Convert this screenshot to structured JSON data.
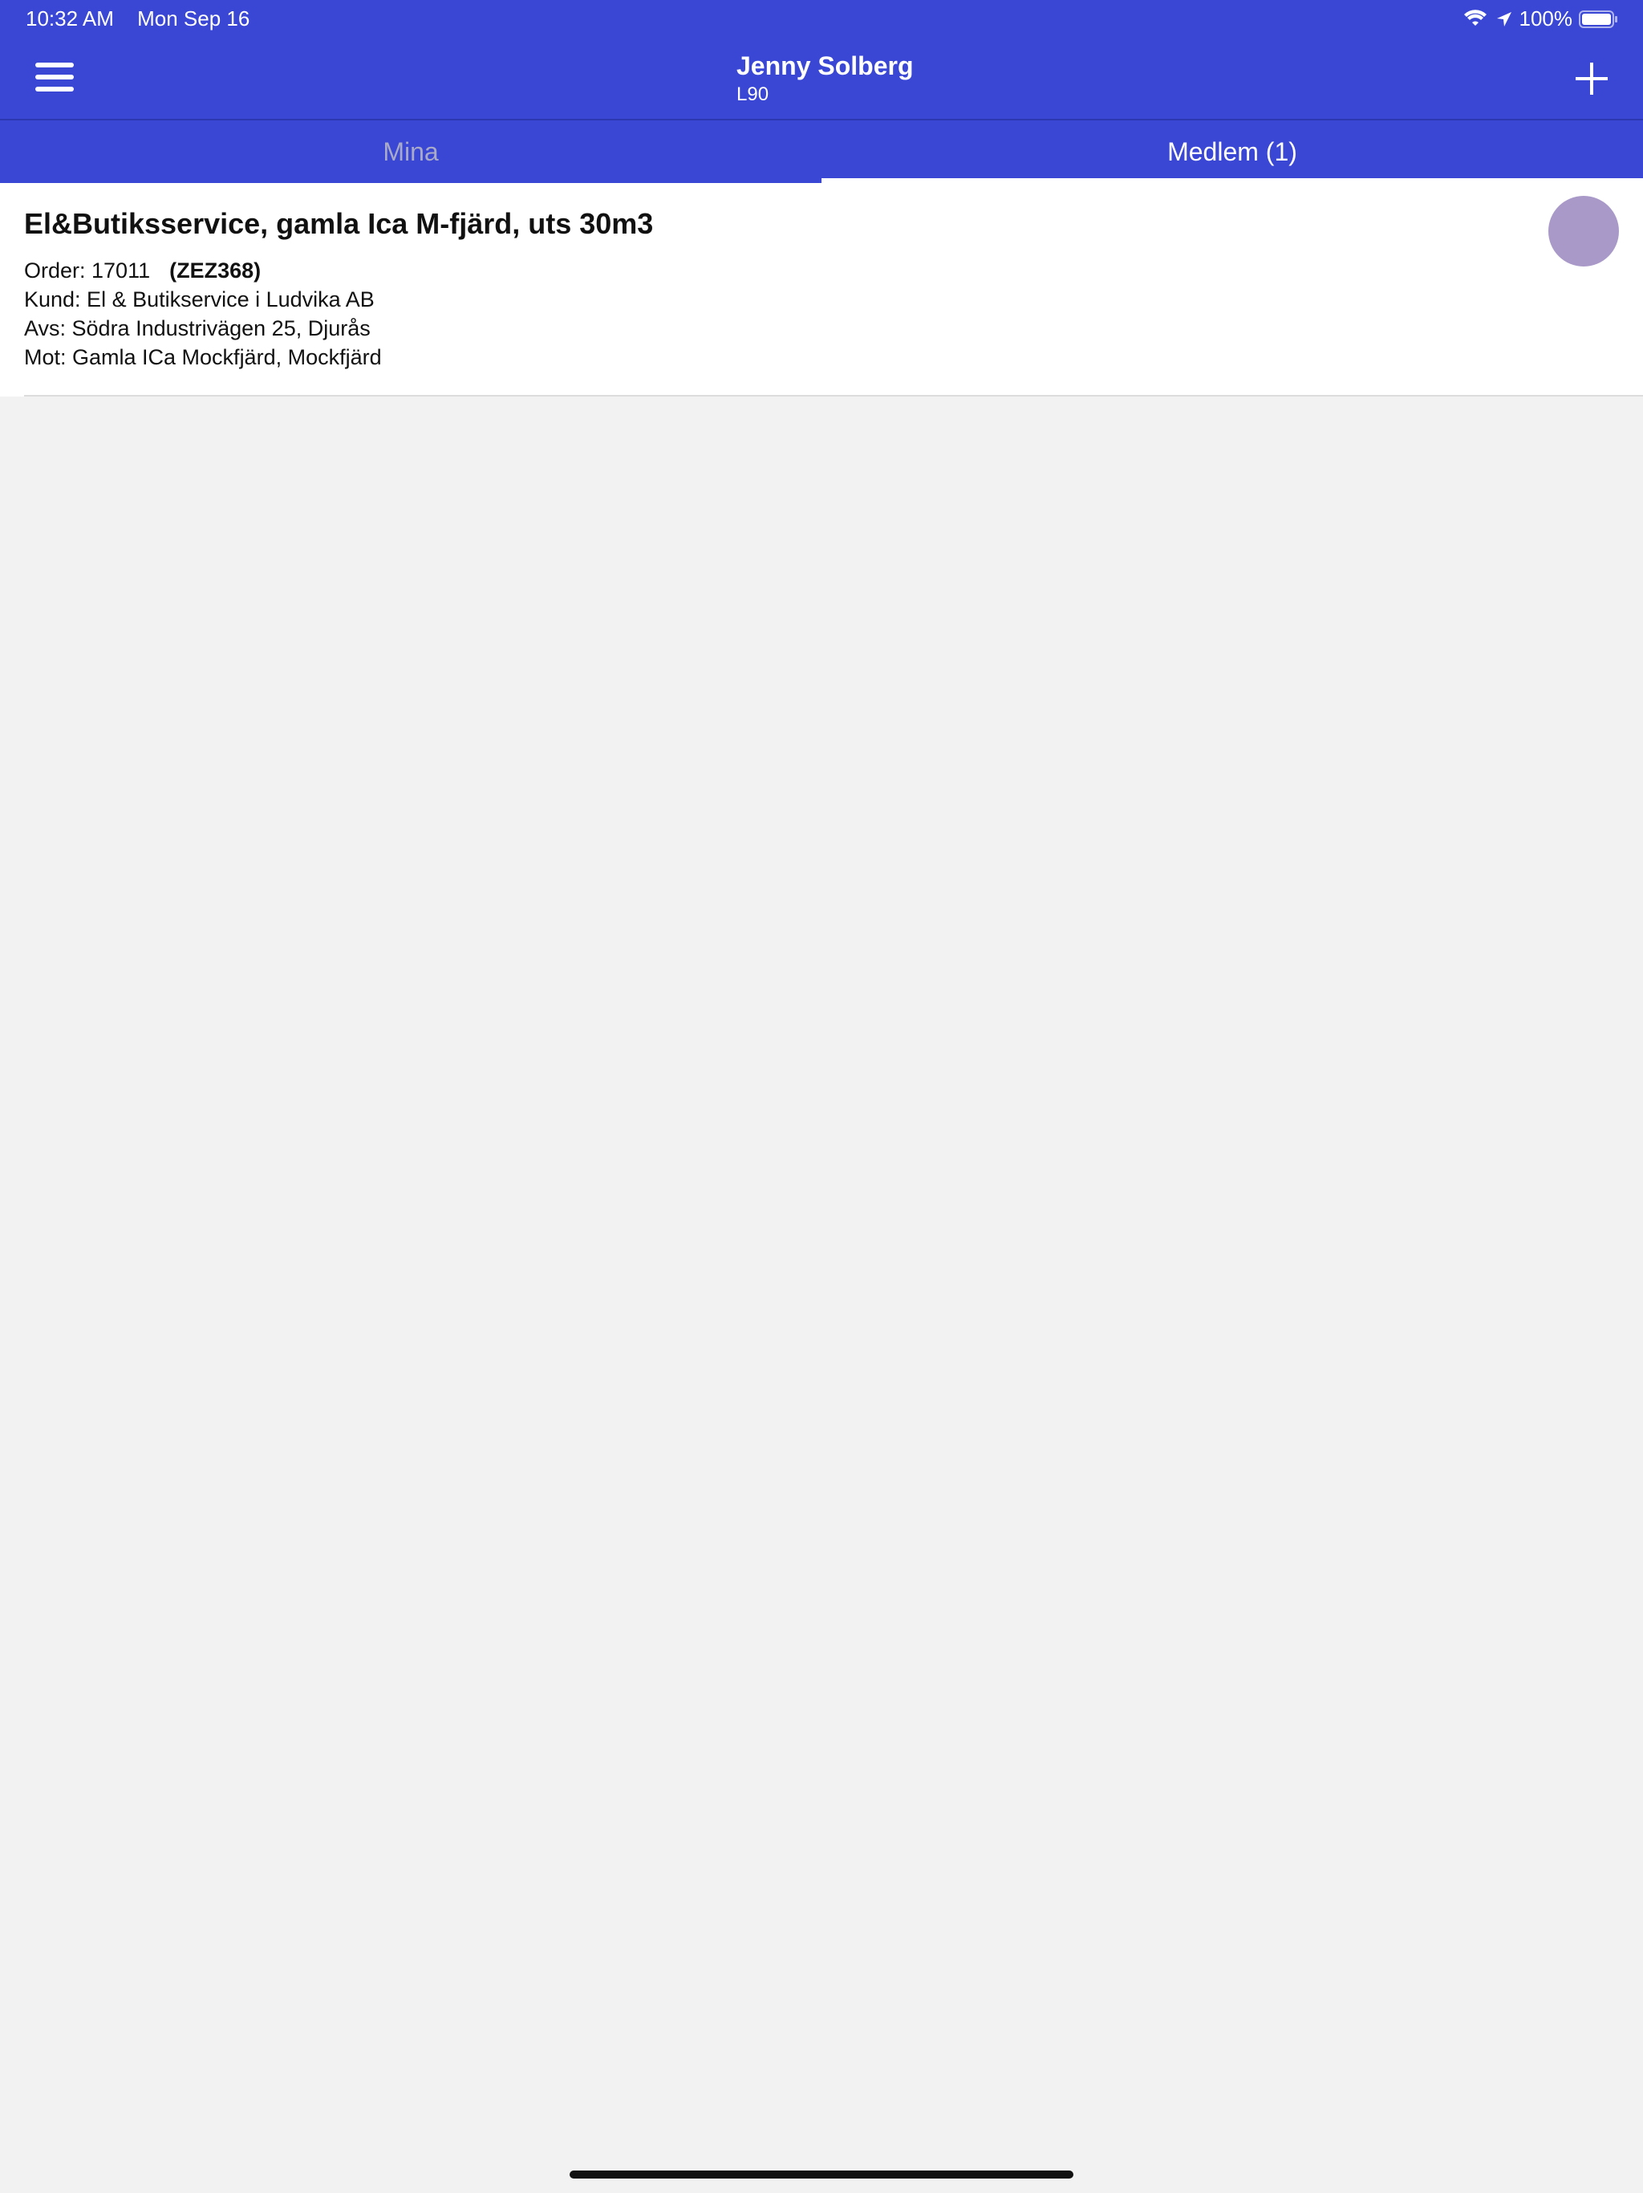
{
  "status_bar": {
    "time": "10:32 AM",
    "date": "Mon Sep 16",
    "battery": "100%",
    "icons": [
      "wifi-icon",
      "location-arrow-icon",
      "battery-icon"
    ]
  },
  "nav": {
    "title": "Jenny Solberg",
    "subtitle": "L90",
    "icons": [
      "menu-icon",
      "plus-icon"
    ]
  },
  "tabs": [
    {
      "label": "Mina",
      "selected": false
    },
    {
      "label": "Medlem (1)",
      "selected": true
    }
  ],
  "orders": [
    {
      "title": "El&Butiksservice, gamla Ica M-fjärd, uts 30m3",
      "order_line": "Order: 17011",
      "registration": "(ZEZ368)",
      "kund": "Kund: El & Butikservice i Ludvika AB",
      "avs": "Avs: Södra Industrivägen 25, Djurås",
      "mot": "Mot: Gamla ICa Mockfjärd, Mockfjärd"
    }
  ],
  "colors": {
    "brand": "#3a47d5",
    "avatar": "#a999c8",
    "background": "#f2f2f2",
    "tab_inactive": "#a9a9c8"
  }
}
